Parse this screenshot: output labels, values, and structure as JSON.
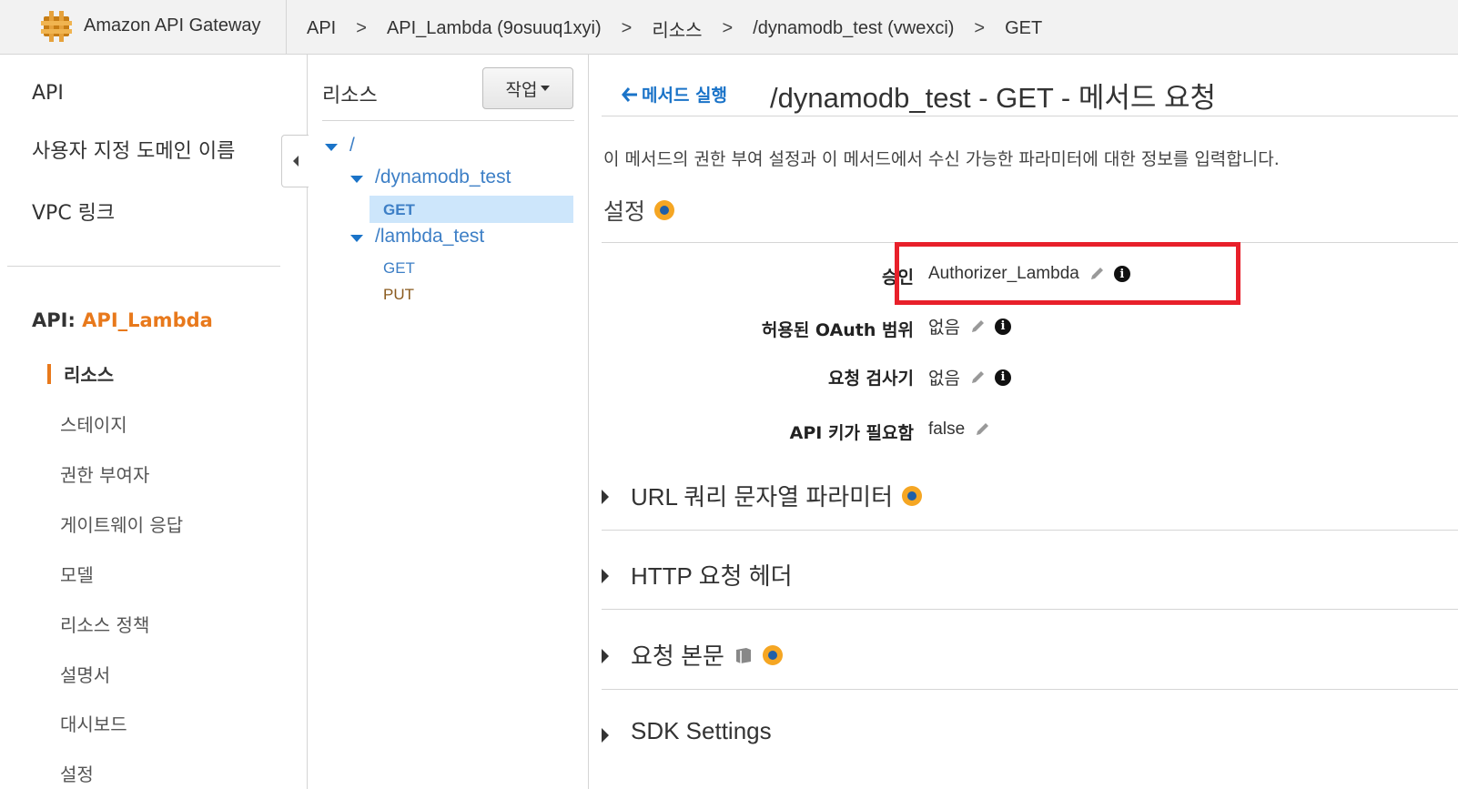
{
  "header": {
    "brand": "Amazon API Gateway",
    "breadcrumbs": [
      "API",
      "API_Lambda (9osuuq1xyi)",
      "리소스",
      "/dynamodb_test (vwexci)",
      "GET"
    ],
    "separator": ">"
  },
  "leftnav": {
    "top_items": [
      "API",
      "사용자 지정 도메인 이름",
      "VPC 링크"
    ],
    "api_prefix": "API:",
    "api_name": "API_Lambda",
    "sub_items": [
      "리소스",
      "스테이지",
      "권한 부여자",
      "게이트웨이 응답",
      "모델",
      "리소스 정책",
      "설명서",
      "대시보드",
      "설정"
    ]
  },
  "resources": {
    "title": "리소스",
    "action_button": "작업",
    "tree": {
      "root": "/",
      "nodes": [
        {
          "path": "/dynamodb_test",
          "methods": [
            "GET"
          ]
        },
        {
          "path": "/lambda_test",
          "methods": [
            "GET",
            "PUT"
          ]
        }
      ]
    }
  },
  "main": {
    "back_link": "메서드 실행",
    "title": "/dynamodb_test - GET - 메서드 요청",
    "description": "이 메서드의 권한 부여 설정과 이 메서드에서 수신 가능한 파라미터에 대한 정보를 입력합니다.",
    "settings_title": "설정",
    "rows": [
      {
        "label": "승인",
        "value": "Authorizer_Lambda"
      },
      {
        "label": "허용된 OAuth 범위",
        "value": "없음"
      },
      {
        "label": "요청 검사기",
        "value": "없음"
      },
      {
        "label": "API 키가 필요함",
        "value": "false"
      }
    ],
    "sections": [
      "URL 쿼리 문자열 파라미터",
      "HTTP 요청 헤더",
      "요청 본문",
      "SDK Settings"
    ]
  },
  "colors": {
    "accent_orange": "#e8791c",
    "link_blue": "#3d7fc6",
    "selected_bg": "#cde6fb",
    "highlight_red": "#e8202a",
    "info_dot": "#f5a623"
  }
}
